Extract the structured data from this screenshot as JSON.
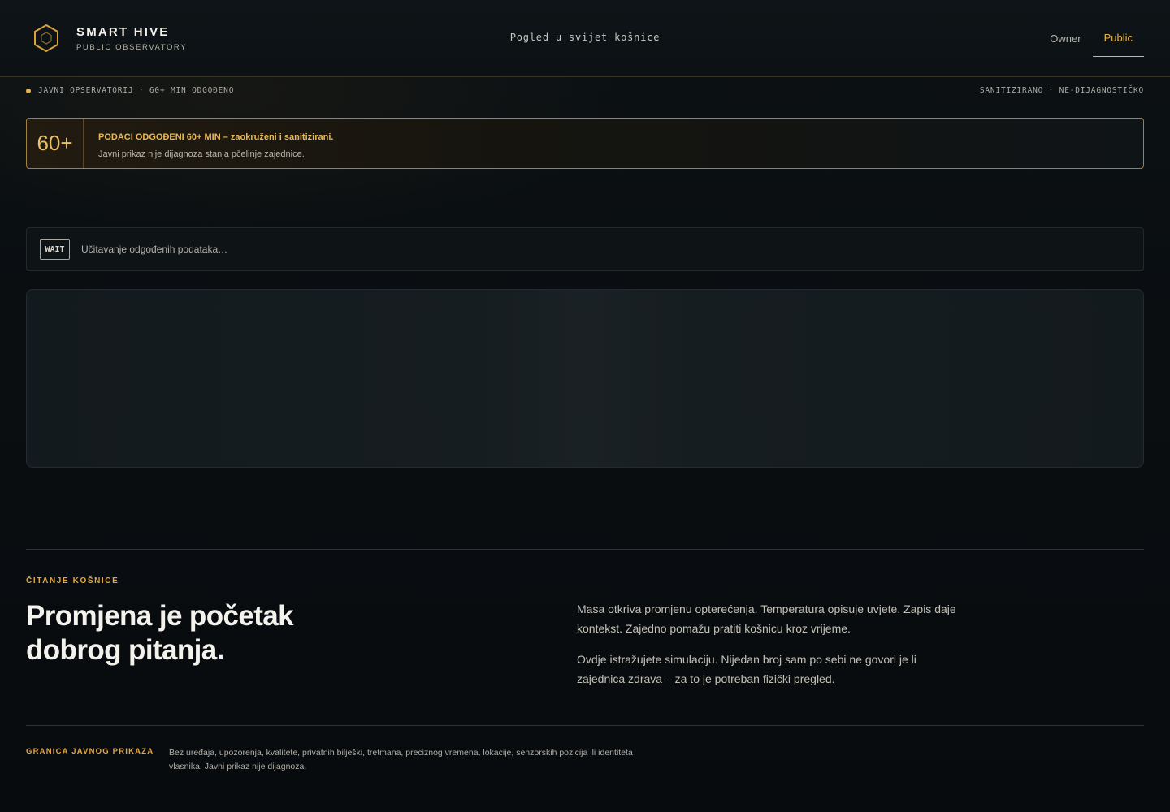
{
  "header": {
    "brand_title": "SMART HIVE",
    "brand_subtitle": "PUBLIC OBSERVATORY",
    "tagline": "Pogled u svijet košnice",
    "nav": [
      {
        "label": "Owner",
        "active": false
      },
      {
        "label": "Public",
        "active": true
      }
    ]
  },
  "status": {
    "left": "JAVNI OPSERVATORIJ · 60+ MIN ODGOĐENO",
    "right": "SANITIZIRANO · NE-DIJAGNOSTIČKO"
  },
  "notice": {
    "number": "60+",
    "title": "PODACI ODGOĐENI 60+ MIN – zaokruženi i sanitizirani.",
    "text": "Javni prikaz nije dijagnoza stanja pčelinje zajednice."
  },
  "loading": {
    "badge": "WAIT",
    "text": "Učitavanje odgođenih podataka…"
  },
  "reading": {
    "eyebrow": "ČITANJE KOŠNICE",
    "headline_line1": "Promjena je početak",
    "headline_line2": "dobrog pitanja.",
    "paragraph1": "Masa otkriva promjenu opterećenja. Temperatura opisuje uvjete. Zapis daje kontekst. Zajedno pomažu pratiti košnicu kroz vrijeme.",
    "paragraph2": "Ovdje istražujete simulaciju. Nijedan broj sam po sebi ne govori je li zajednica zdrava – za to je potreban fizički pregled."
  },
  "boundary": {
    "label": "GRANICA JAVNOG PRIKAZA",
    "text": "Bez uređaja, upozorenja, kvalitete, privatnih bilješki, tretmana, preciznog vremena, lokacije, senzorskih pozicija ili identiteta vlasnika. Javni prikaz nije dijagnoza."
  },
  "colors": {
    "accent": "#e9b54a",
    "background": "#0a0e11"
  },
  "icons": {
    "brand": "hexagon-icon",
    "status": "dot-icon"
  }
}
